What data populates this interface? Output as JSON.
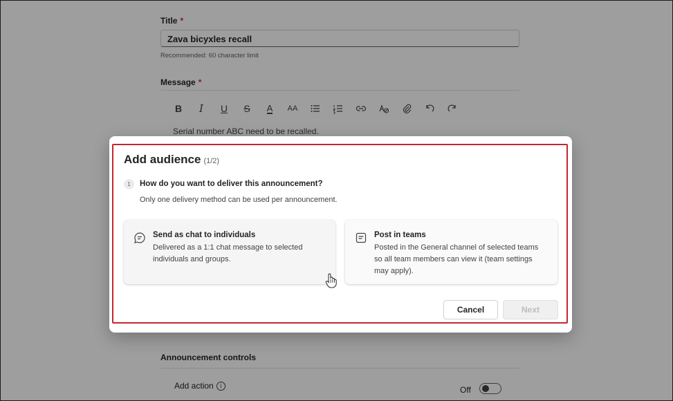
{
  "form": {
    "title_label": "Title",
    "required_mark": "*",
    "title_value": "Zava bicyxles recall",
    "title_hint": "Recommended: 60 character limit",
    "message_label": "Message",
    "message_text": "Serial number ABC need to be recalled.",
    "toolbar": {
      "bold": "B",
      "italic": "I",
      "underline": "U",
      "strikethrough": "S",
      "font_color": "A",
      "font_size": "AA"
    },
    "controls_label": "Announcement controls",
    "add_action_label": "Add action",
    "info_glyph": "i",
    "toggle_label": "Off"
  },
  "dialog": {
    "title": "Add audience",
    "step": "(1/2)",
    "question_number": "1",
    "question": "How do you want to deliver this announcement?",
    "question_sub": "Only one delivery method can be used per announcement.",
    "options": [
      {
        "title": "Send as chat to individuals",
        "description": "Delivered as a 1:1 chat message to selected individuals and groups.",
        "icon": "chat-icon"
      },
      {
        "title": "Post in teams",
        "description": "Posted in the General channel of selected teams so all team members can view it (team settings may apply).",
        "icon": "post-icon"
      }
    ],
    "cancel_label": "Cancel",
    "next_label": "Next"
  },
  "colors": {
    "highlight": "#c4262e",
    "required": "#c4314b",
    "disabled_text": "#bdbdbd"
  }
}
